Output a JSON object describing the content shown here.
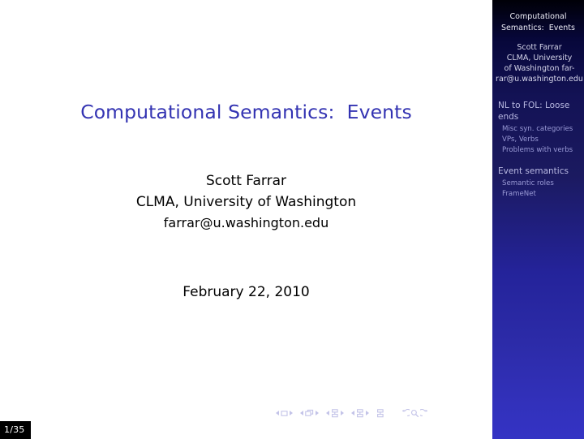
{
  "slide": {
    "title": "Computational Semantics:  Events",
    "author_lines": [
      "Scott Farrar",
      "CLMA, University of Washington"
    ],
    "email": "farrar@u.washington.edu",
    "date": "February 22, 2010",
    "page_indicator": "1/35",
    "title_color": "#3333b2",
    "background_color": "#ffffff"
  },
  "sidebar": {
    "title_lines": [
      "Computational",
      "Semantics:  Events"
    ],
    "author_lines": [
      "Scott Farrar",
      "CLMA, University",
      "of Washington far-",
      "rar@u.washington.edu"
    ],
    "gradient_top_color": "#000007",
    "gradient_bottom_color": "#3433c4",
    "sections": [
      {
        "label": "NL to FOL: Loose ends",
        "subsections": [
          "Misc syn. categories",
          "VPs, Verbs",
          "Problems with verbs"
        ]
      },
      {
        "label": "Event semantics",
        "subsections": [
          "Semantic roles",
          "FrameNet"
        ]
      }
    ]
  },
  "navigation": {
    "groups": [
      {
        "icon": "frame-icon",
        "has_arrows": true
      },
      {
        "icon": "subsection-icon",
        "has_arrows": true
      },
      {
        "icon": "section-icon",
        "has_arrows": true
      },
      {
        "icon": "presentation-icon",
        "has_arrows": true
      },
      {
        "icon": "document-icon",
        "has_arrows": false
      }
    ],
    "back_icon": "back-arrow-icon",
    "search_icon": "search-icon",
    "forward_icon": "forward-arrow-icon",
    "symbol_color": "#c3c3e8"
  }
}
